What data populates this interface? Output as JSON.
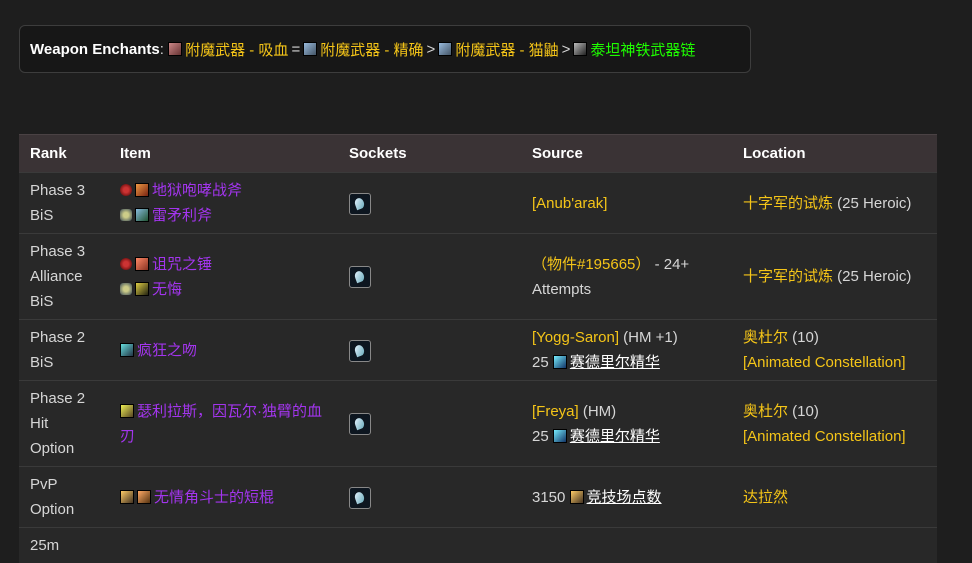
{
  "enchants": {
    "label": "Weapon Enchants",
    "colon": ":",
    "items": [
      {
        "text": "附魔武器 - 吸血",
        "color": "gold",
        "icon": "scroll-icon"
      },
      {
        "text": "附魔武器 - 精确",
        "color": "gold",
        "icon": "scroll-icon"
      },
      {
        "text": "附魔武器 - 猫鼬",
        "color": "gold",
        "icon": "scroll-icon"
      },
      {
        "text": "泰坦神铁武器链",
        "color": "green",
        "icon": "chain-icon"
      }
    ],
    "separators": [
      "=",
      ">",
      ">"
    ]
  },
  "table": {
    "headers": [
      "Rank",
      "Item",
      "Sockets",
      "Source",
      "Location"
    ],
    "rows": [
      {
        "rank": [
          "Phase 3",
          "BiS"
        ],
        "items": [
          {
            "faction": "horde",
            "name": "地狱咆哮战斧",
            "icon": "axe-icon"
          },
          {
            "faction": "alliance",
            "name": "雷矛利斧",
            "icon": "axe-icon"
          }
        ],
        "source": {
          "line1": "[Anub'arak]",
          "line1_color": "gold"
        },
        "location": {
          "zone": "十字军的试炼",
          "suffix": " (25 Heroic)"
        }
      },
      {
        "rank": [
          "Phase 3",
          "Alliance",
          "BiS"
        ],
        "items": [
          {
            "faction": "horde",
            "name": "诅咒之锤",
            "icon": "mace-icon"
          },
          {
            "faction": "alliance",
            "name": "无悔",
            "icon": "mace-icon"
          }
        ],
        "source": {
          "line1": "（物件#195665）",
          "line1_suffix": " - 24+",
          "line2": "Attempts"
        },
        "location": {
          "zone": "十字军的试炼",
          "suffix": " (25 Heroic)"
        }
      },
      {
        "rank": [
          "Phase 2",
          "BiS"
        ],
        "items": [
          {
            "name": "疯狂之吻",
            "icon": "dagger-icon"
          }
        ],
        "source": {
          "line1": "[Yogg-Saron]",
          "line1_suffix": " (HM +1)",
          "count": "25",
          "currency": "赛德里尔精华"
        },
        "location": {
          "zone": "奥杜尔",
          "suffix": " (10)",
          "line2": "[Animated Constellation]"
        }
      },
      {
        "rank": [
          "Phase 2",
          "Hit",
          "Option"
        ],
        "items": [
          {
            "name": "瑟利拉斯，因瓦尔·独臂的血刃",
            "icon": "sword-icon"
          }
        ],
        "source": {
          "line1": "[Freya]",
          "line1_suffix": " (HM)",
          "count": "25",
          "currency": "赛德里尔精华"
        },
        "location": {
          "zone": "奥杜尔",
          "suffix": " (10)",
          "line2": "[Animated Constellation]"
        }
      },
      {
        "rank": [
          "PvP",
          "Option"
        ],
        "items": [
          {
            "name": "无情角斗士的短棍",
            "icon": "staff-icon"
          }
        ],
        "source": {
          "count": "3150",
          "currency": "竞技场点数"
        },
        "location": {
          "zone": "达拉然"
        }
      }
    ],
    "partial_rank": "25m"
  }
}
